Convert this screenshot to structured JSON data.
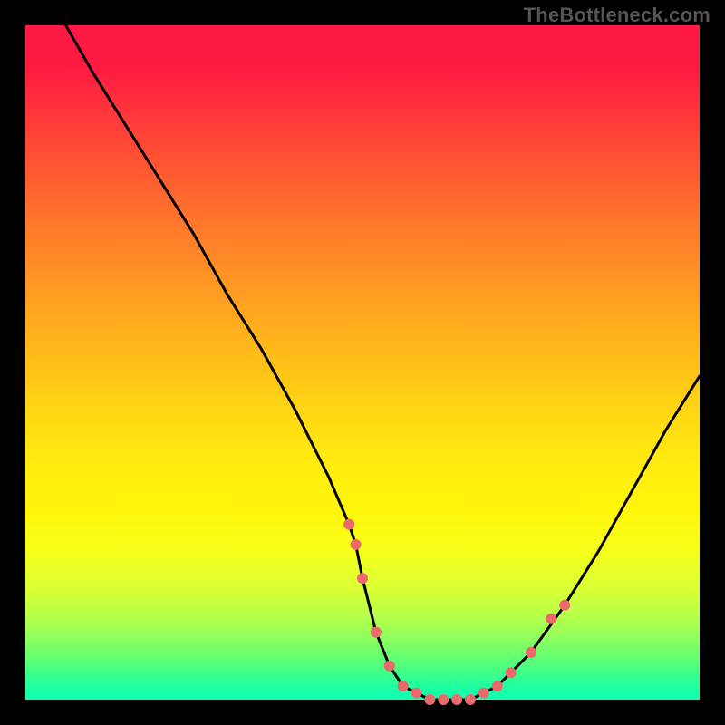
{
  "watermark": "TheBottleneck.com",
  "chart_data": {
    "type": "line",
    "title": "",
    "xlabel": "",
    "ylabel": "",
    "xlim": [
      0,
      100
    ],
    "ylim": [
      0,
      100
    ],
    "grid": false,
    "legend": false,
    "line": {
      "name": "curve",
      "color": "#000000",
      "x": [
        6,
        10,
        15,
        20,
        25,
        30,
        35,
        40,
        45,
        48,
        49,
        50,
        52,
        54,
        56,
        58,
        60,
        62,
        64,
        66,
        68,
        70,
        72,
        75,
        80,
        85,
        90,
        95,
        100
      ],
      "y": [
        100,
        93,
        85,
        77,
        69,
        60,
        52,
        43,
        33,
        26,
        23,
        18,
        10,
        5,
        2,
        1,
        0,
        0,
        0,
        0,
        1,
        2,
        4,
        7,
        14,
        22,
        31,
        40,
        48
      ]
    },
    "points": {
      "name": "markers",
      "color": "#e96a6a",
      "radius": 6,
      "x": [
        48,
        49,
        50,
        52,
        54,
        56,
        58,
        60,
        62,
        64,
        66,
        68,
        70,
        72,
        75,
        78,
        80
      ],
      "y": [
        26,
        23,
        18,
        10,
        5,
        2,
        1,
        0,
        0,
        0,
        0,
        1,
        2,
        4,
        7,
        12,
        14
      ]
    }
  }
}
